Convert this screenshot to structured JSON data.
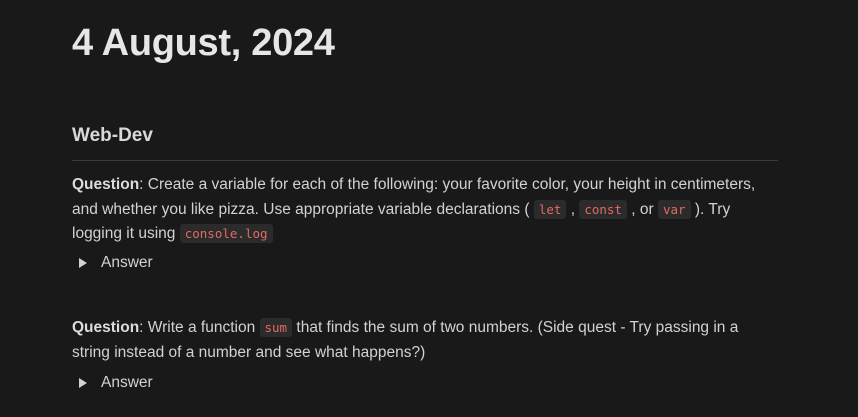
{
  "page": {
    "title": "4 August, 2024",
    "section_heading": "Web-Dev"
  },
  "questions": [
    {
      "label": "Question",
      "seg_a": ": Create a variable for each of the following: your favorite color, your height in centimeters, and whether you like pizza. Use appropriate variable declarations (",
      "code_a": "let",
      "seg_b": ",",
      "code_b": "const",
      "seg_c": ", or",
      "code_c": "var",
      "seg_d": "). Try logging it using",
      "code_d": "console.log",
      "answer_label": "Answer"
    },
    {
      "label": "Question",
      "seg_a": ": Write a function",
      "code_a": "sum",
      "seg_b": "that finds the sum of two numbers. (Side quest - Try passing in a string instead of a number and see what happens?)",
      "answer_label": "Answer"
    }
  ],
  "colors": {
    "background": "#191919",
    "inline_code_text": "#e26a63",
    "inline_code_bg": "#2b2b2b"
  },
  "icons": {
    "toggle": "triangle-right-icon"
  }
}
